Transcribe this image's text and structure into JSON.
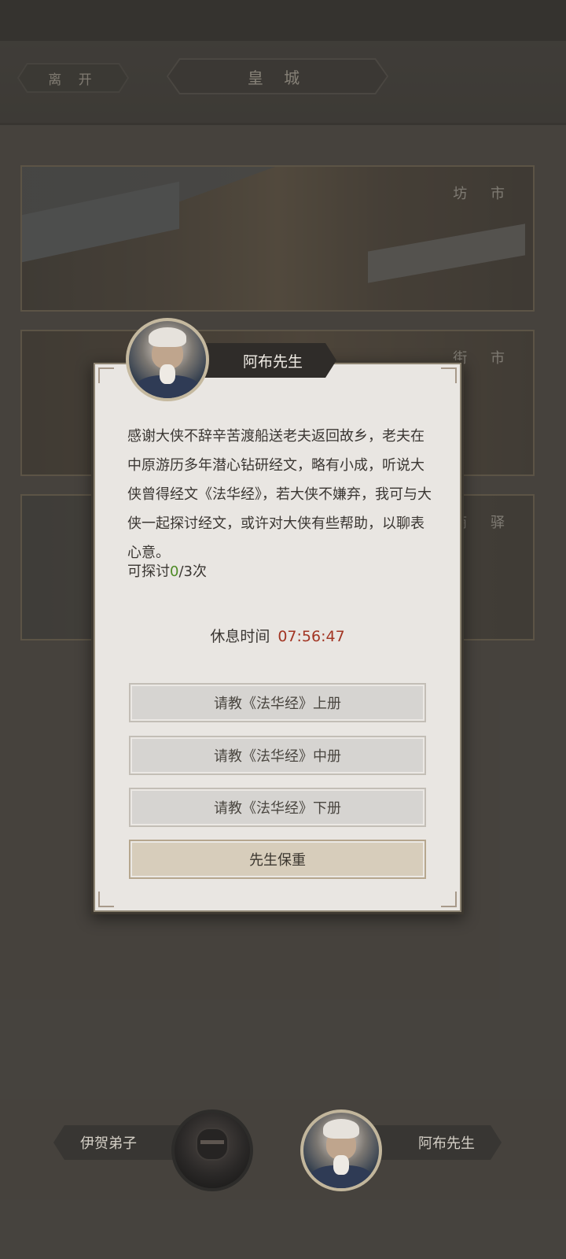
{
  "header": {
    "leave_label": "离 开",
    "title": "皇 城"
  },
  "locations": [
    {
      "label": "坊 市"
    },
    {
      "label": "街 市"
    },
    {
      "label": "商 驿"
    }
  ],
  "dialog": {
    "npc_name": "阿布先生",
    "message": "感谢大侠不辞辛苦渡船送老夫返回故乡，老夫在中原游历多年潜心钻研经文，略有小成，听说大侠曾得经文《法华经》，若大侠不嫌弃，我可与大侠一起探讨经文，或许对大侠有些帮助，以聊表心意。",
    "attempts_prefix": "可探讨",
    "attempts_used": "0",
    "attempts_suffix": "/3次",
    "rest_label": "休息时间",
    "rest_timer": "07:56:47",
    "options": [
      "请教《法华经》上册",
      "请教《法华经》中册",
      "请教《法华经》下册"
    ],
    "farewell": "先生保重"
  },
  "npcs": [
    {
      "name": "伊贺弟子"
    },
    {
      "name": "阿布先生"
    }
  ],
  "colors": {
    "timer": "#a23523",
    "attempts_used": "#4d8a25"
  }
}
